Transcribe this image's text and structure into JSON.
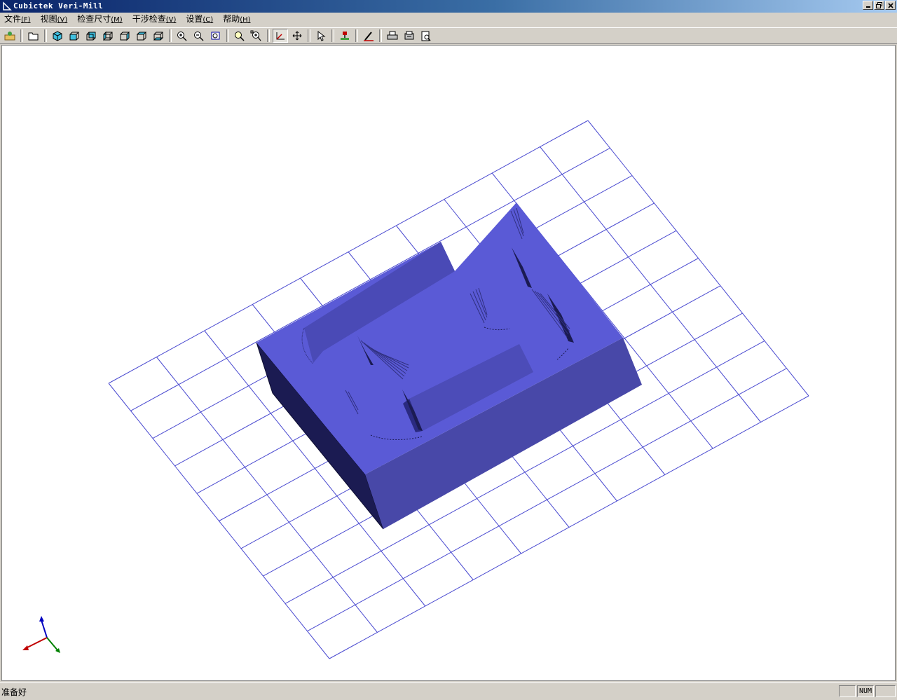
{
  "window": {
    "title": "Cubictek Veri-Mill"
  },
  "menu": [
    {
      "label": "文件",
      "key": "(F)"
    },
    {
      "label": "视图",
      "key": "(V)"
    },
    {
      "label": "检查尺寸",
      "key": "(M)"
    },
    {
      "label": "干涉检查",
      "key": "(V)"
    },
    {
      "label": "设置",
      "key": "(C)"
    },
    {
      "label": "帮助",
      "key": "(H)"
    }
  ],
  "toolbar_icons": [
    "open-stock-icon",
    "open-file-icon",
    "iso-view-icon",
    "front-view-icon",
    "back-view-icon",
    "left-view-icon",
    "right-view-icon",
    "top-view-icon",
    "bottom-view-icon",
    "zoom-in-icon",
    "zoom-out-icon",
    "zoom-window-icon",
    "zoom-all-icon",
    "zoom-fit-icon",
    "rotate-icon",
    "pan-icon",
    "select-icon",
    "simulate-icon",
    "measure-icon",
    "print-icon",
    "print-setup-icon",
    "print-preview-icon"
  ],
  "status": {
    "message": "准备好",
    "num": "NUM"
  },
  "colors": {
    "part_top": "#5a5ad6",
    "part_side": "#4747a8",
    "part_dark": "#1a1a50",
    "grid": "#4a4ad0"
  }
}
